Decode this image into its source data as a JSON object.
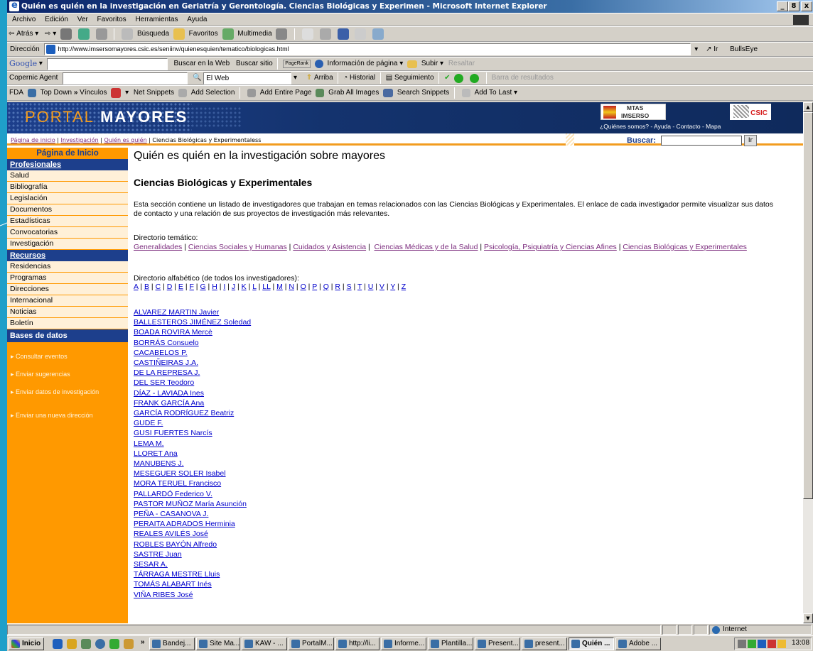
{
  "window": {
    "title": "Quién es quién en la investigación en Geriatría y Gerontología. Ciencias Biológicas y Experimen - Microsoft Internet Explorer",
    "min": "_",
    "max": "8",
    "close": "x"
  },
  "menu": [
    "Archivo",
    "Edición",
    "Ver",
    "Favoritos",
    "Herramientas",
    "Ayuda"
  ],
  "toolbar": {
    "back": "Atrás",
    "search": "Búsqueda",
    "favorites": "Favoritos",
    "multimedia": "Multimedia"
  },
  "address": {
    "label": "Dirección",
    "url": "http://www.imsersomayores.csic.es/seniinv/quienesquien/tematico/biologicas.html",
    "go": "Ir",
    "bullseye": "BullsEye"
  },
  "google": {
    "logo": "Google",
    "search_web": "Buscar en la Web",
    "search_site": "Buscar sitio",
    "pagerank": "PageRank",
    "page_info": "Información de página",
    "up": "Subir",
    "highlight": "Resaltar"
  },
  "copernic": {
    "label": "Copernic Agent",
    "scope": "El Web",
    "up": "Arriba",
    "history": "Historial",
    "tracking": "Seguimiento",
    "results_bar": "Barra de resultados"
  },
  "snippets": {
    "fda": "FDA",
    "top_down": "Top Down",
    "links": "Vínculos",
    "net_snippets": "Net Snippets",
    "add_selection": "Add Selection",
    "add_entire_page": "Add Entire Page",
    "grab_all_images": "Grab All Images",
    "search_snippets": "Search Snippets",
    "add_to_last": "Add To Last"
  },
  "header": {
    "logo_part1": "PORTAL",
    "logo_part2": "MAYORES",
    "mtas_line1": "MTAS",
    "mtas_line2": "IMSERSO",
    "csic": "CSIC",
    "top_menu": "¿Quiénes somos? - Ayuda - Contacto - Mapa",
    "search_label": "Buscar:",
    "search_go": "Ir"
  },
  "breadcrumb": {
    "home": "Página de inicio",
    "research": "Investigación",
    "who": "Quién es quién",
    "current": "Ciencias Biológicas y Experimentaless"
  },
  "sidebar": {
    "top": "Página de Inicio",
    "profesionales": "Profesionales",
    "prof_items": [
      "Salud",
      "Bibliografía",
      "Legislación",
      "Documentos",
      "Estadísticas",
      "Convocatorias",
      "Investigación"
    ],
    "recursos": "Recursos",
    "rec_items": [
      "Residencias",
      "Programas",
      "Direcciones",
      "Internacional",
      "Noticias",
      "Boletín"
    ],
    "bases": "Bases de datos",
    "links": [
      "Consultar eventos",
      "Enviar sugerencias",
      "Enviar datos de investigación",
      "Enviar una nueva dirección"
    ]
  },
  "main": {
    "title": "Quién es quién en la investigación sobre mayores",
    "subtitle": "Ciencias Biológicas y Experimentales",
    "paragraph": "Esta sección contiene un listado de investigadores que trabajan en temas relacionados con las Ciencias Biológicas y Experimentales. El enlace de cada investigador permite visualizar sus datos de contacto y una relación de sus proyectos de investigación más relevantes.",
    "thematic_label": "Directorio temático:",
    "thematic": [
      "Generalidades",
      "Ciencias Sociales y Humanas",
      "Cuidados y Asistencia",
      "Ciencias Médicas y de la Salud",
      "Psicología, Psiquiatría y Ciencias Afines",
      "Ciencias Biológicas y Experimentales"
    ],
    "alpha_label": "Directorio alfabético (de todos los investigadores):",
    "alphabet": [
      "A",
      "B",
      "C",
      "D",
      "E",
      "F",
      "G",
      "H",
      "I",
      "J",
      "K",
      "L",
      "LL",
      "M",
      "N",
      "O",
      "P",
      "Q",
      "R",
      "S",
      "T",
      "U",
      "V",
      "Y",
      "Z"
    ],
    "researchers": [
      "ALVAREZ MARTIN Javier",
      "BALLESTEROS JIMÉNEZ Soledad",
      "BOADA ROVIRA Mercè",
      "BORRÁS Consuelo",
      "CACABELOS P.",
      "CASTIÑEIRAS J.A.",
      "DE LA REPRESA J.",
      "DEL SER Teodoro",
      "DÍAZ - LAVIADA Ines",
      "FRANK GARCÍA Ana",
      "GARCÍA RODRÍGUEZ Beatriz",
      "GUDE F.",
      "GUSI FUERTES Narcís",
      "LEMA M.",
      "LLORET Ana",
      "MANUBENS J.",
      "MESEGUER SOLER Isabel",
      "MORA TERUEL Francisco",
      "PALLARDÓ Federico V.",
      "PASTOR MUÑOZ María Asunción",
      "PEÑA - CASANOVA J.",
      "PERAITA ADRADOS Herminia",
      "REALES AVILÉS José",
      "ROBLES BAYÓN Alfredo",
      "SASTRE Juan",
      "SESAR A.",
      "TÁRRAGA MESTRE Lluis",
      "TOMÁS ALABART Inés",
      "VIÑA RIBES José"
    ]
  },
  "status": {
    "zone": "Internet"
  },
  "taskbar": {
    "start": "Inicio",
    "tasks": [
      "Bandej...",
      "Site Ma...",
      "KAW - ...",
      "PortalM...",
      "http://li...",
      "Informe...",
      "Plantilla...",
      "Present...",
      "present...",
      "Quién ...",
      "Adobe ..."
    ],
    "clock": "13:08"
  },
  "colors": {
    "banner": "#1d3f8c",
    "orange": "#ff9900",
    "link_visited": "#7b2b7d",
    "link": "#0000cc",
    "desktop": "#1f9fc9"
  }
}
